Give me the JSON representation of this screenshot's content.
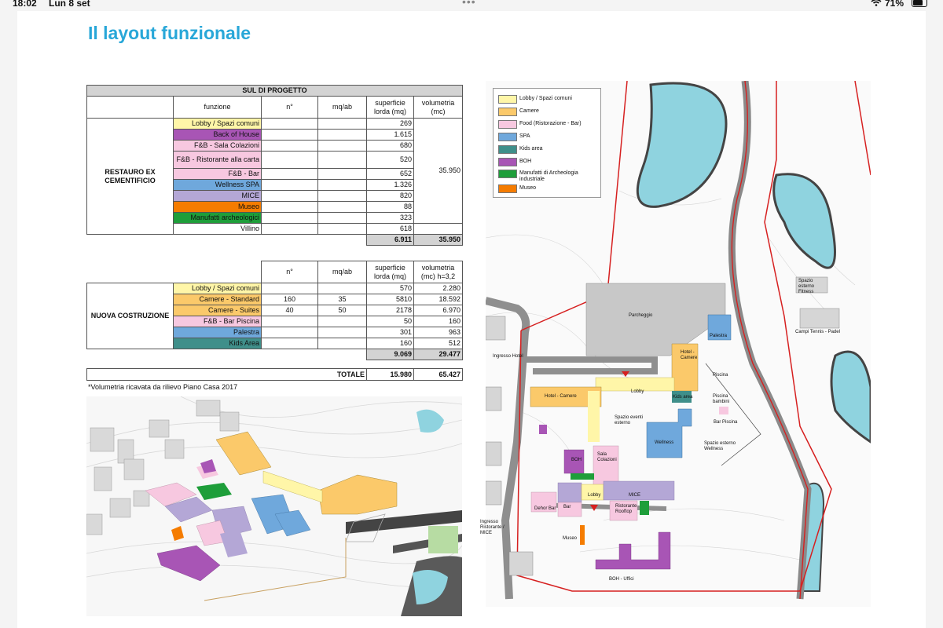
{
  "status_bar": {
    "time": "18:02",
    "date": "Lun 8 set",
    "battery": "71%"
  },
  "title": "Il layout funzionale",
  "table1": {
    "title": "SUL DI PROGETTO",
    "headers": {
      "funzione": "funzione",
      "n": "n°",
      "mqab": "mq/ab",
      "superficie": "superficie lorda (mq)",
      "volumetria": "volumetria (mc)"
    },
    "section": "RESTAURO EX CEMENTIFICIO",
    "rows": [
      {
        "label": "Lobby / Spazi comuni",
        "superficie": "269"
      },
      {
        "label": "Back of House",
        "superficie": "1.615"
      },
      {
        "label": "F&B - Sala Colazioni",
        "superficie": "680"
      },
      {
        "label": "F&B - Ristorante alla carta",
        "superficie": "520"
      },
      {
        "label": "F&B - Bar",
        "superficie": "652"
      },
      {
        "label": "Wellness SPA",
        "superficie": "1.326"
      },
      {
        "label": "MICE",
        "superficie": "820"
      },
      {
        "label": "Museo",
        "superficie": "88"
      },
      {
        "label": "Manufatti archeologici",
        "superficie": "323"
      },
      {
        "label": "Villino",
        "superficie": "618"
      }
    ],
    "volumetria_group": "35.950",
    "total_superficie": "6.911",
    "total_volumetria": "35.950"
  },
  "table2": {
    "headers": {
      "n": "n°",
      "mqab": "mq/ab",
      "superficie": "superficie lorda (mq)",
      "volumetria": "volumetria (mc) h=3,2"
    },
    "section": "NUOVA COSTRUZIONE",
    "rows": [
      {
        "label": "Lobby / Spazi comuni",
        "n": "",
        "mqab": "",
        "superficie": "570",
        "volumetria": "2.280"
      },
      {
        "label": "Camere  - Standard",
        "n": "160",
        "mqab": "35",
        "superficie": "5810",
        "volumetria": "18.592"
      },
      {
        "label": "Camere  - Suites",
        "n": "40",
        "mqab": "50",
        "superficie": "2178",
        "volumetria": "6.970"
      },
      {
        "label": "F&B - Bar Piscina",
        "n": "",
        "mqab": "",
        "superficie": "50",
        "volumetria": "160"
      },
      {
        "label": "Palestra",
        "n": "",
        "mqab": "",
        "superficie": "301",
        "volumetria": "963"
      },
      {
        "label": "Kids Area",
        "n": "",
        "mqab": "",
        "superficie": "160",
        "volumetria": "512"
      }
    ],
    "total_superficie": "9.069",
    "total_volumetria": "29.477"
  },
  "table3": {
    "label": "TOTALE",
    "superficie": "15.980",
    "volumetria": "65.427"
  },
  "note": "*Volumetria ricavata da rilievo Piano Casa 2017",
  "legend": {
    "items": [
      {
        "label": "Lobby / Spazi comuni",
        "color": "#fff6a8"
      },
      {
        "label": "Camere",
        "color": "#fbc96a"
      },
      {
        "label": "Food (Ristorazione - Bar)",
        "color": "#f7c8e0"
      },
      {
        "label": "SPA",
        "color": "#6fa8dc"
      },
      {
        "label": "Kids area",
        "color": "#3f8f8a"
      },
      {
        "label": "BOH",
        "color": "#a855b5"
      },
      {
        "label": "Manufatti di Archeologia industriale",
        "color": "#1e9e3a"
      },
      {
        "label": "Museo",
        "color": "#f57c00"
      }
    ]
  },
  "plan_labels": {
    "parcheggio": "Parcheggio",
    "palestra": "Palestra",
    "hotel_camere_e": "Hotel - Camere",
    "hotel_camere_w": "Hotel - Camere",
    "lobby_top": "Lobby",
    "kids_area": "Kids area",
    "piscina": "Piscina",
    "piscina_bambini": "Piscina bambini",
    "bar_piscina": "Bar Piscina",
    "spazio_eventi": "Spazio eventi esterno",
    "wellness": "Wellness",
    "spazio_wellness": "Spazio esterno Wellness",
    "boh": "BOH",
    "sala_colazioni": "Sala Colazioni",
    "lobby_bottom": "Lobby",
    "mice": "MICE",
    "dehor_bar": "Dehor Bar",
    "bar": "Bar",
    "ristorante_rooftop": "Ristorante Rooftop",
    "museo": "Museo",
    "boh_uffici": "BOH - Uffici",
    "ingresso_hotel": "Ingresso Hotel",
    "ingresso_ristorante": "Ingresso Ristorante / MICE",
    "spazio_fitness": "Spazio esterno Fitness",
    "campi_tennis": "Campi Tennis - Padel"
  },
  "colors": {
    "title": "#28a7d8",
    "boundary": "#d62020",
    "water": "#8fd3df"
  }
}
